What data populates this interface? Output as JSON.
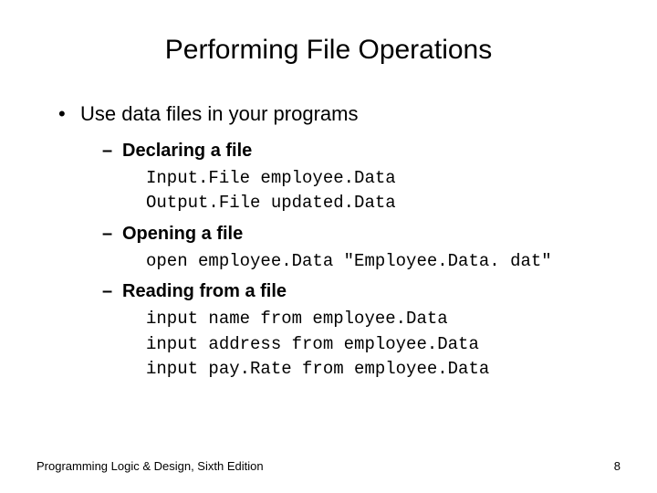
{
  "title": "Performing File Operations",
  "main_bullet": "Use data files in your programs",
  "sections": [
    {
      "heading": "Declaring a file",
      "code": [
        "Input.File employee.Data",
        "Output.File updated.Data"
      ]
    },
    {
      "heading": "Opening a file",
      "code": [
        "open employee.Data \"Employee.Data. dat\""
      ]
    },
    {
      "heading": "Reading from a file",
      "code": [
        "input name from employee.Data",
        "input address from employee.Data",
        "input pay.Rate from employee.Data"
      ]
    }
  ],
  "footer": {
    "left": "Programming Logic & Design, Sixth Edition",
    "right": "8"
  }
}
